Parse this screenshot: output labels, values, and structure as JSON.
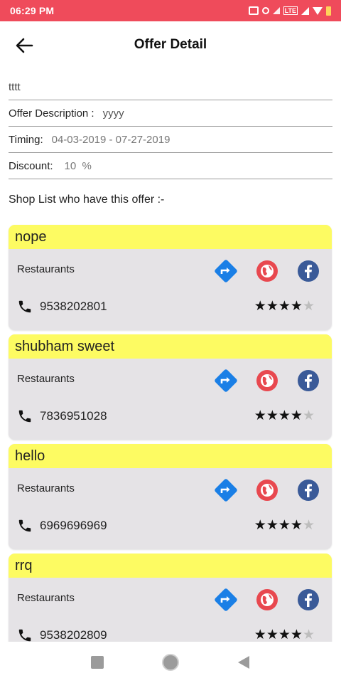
{
  "status_bar": {
    "time": "06:29 PM",
    "lte_label": "LTE"
  },
  "header": {
    "title": "Offer Detail"
  },
  "offer": {
    "name": "tttt",
    "description_label": "Offer Description :",
    "description_value": "yyyy",
    "timing_label": "Timing:",
    "timing_value": "04-03-2019 - 07-27-2019",
    "discount_label": "Discount:",
    "discount_value": "10  %"
  },
  "section_title": "Shop List who have this offer :-",
  "shops": [
    {
      "name": "nope",
      "category": "Restaurants",
      "phone": "9538202801",
      "rating": 4,
      "max_rating": 5
    },
    {
      "name": "shubham sweet",
      "category": "Restaurants",
      "phone": "7836951028",
      "rating": 4,
      "max_rating": 5
    },
    {
      "name": "hello",
      "category": "Restaurants",
      "phone": "6969696969",
      "rating": 4,
      "max_rating": 5
    },
    {
      "name": "rrq",
      "category": "Restaurants",
      "phone": "9538202809",
      "rating": 4,
      "max_rating": 5
    }
  ],
  "icons": {
    "back": "arrow-left-icon",
    "directions": "directions-icon",
    "website": "globe-icon",
    "facebook": "facebook-icon",
    "phone": "phone-icon"
  },
  "colors": {
    "status_bar": "#ef4b5b",
    "card_header": "#fdfb62",
    "card_body": "#e5e3e6",
    "directions": "#1a7fe6",
    "website": "#e8484f",
    "facebook": "#3a5a98"
  }
}
